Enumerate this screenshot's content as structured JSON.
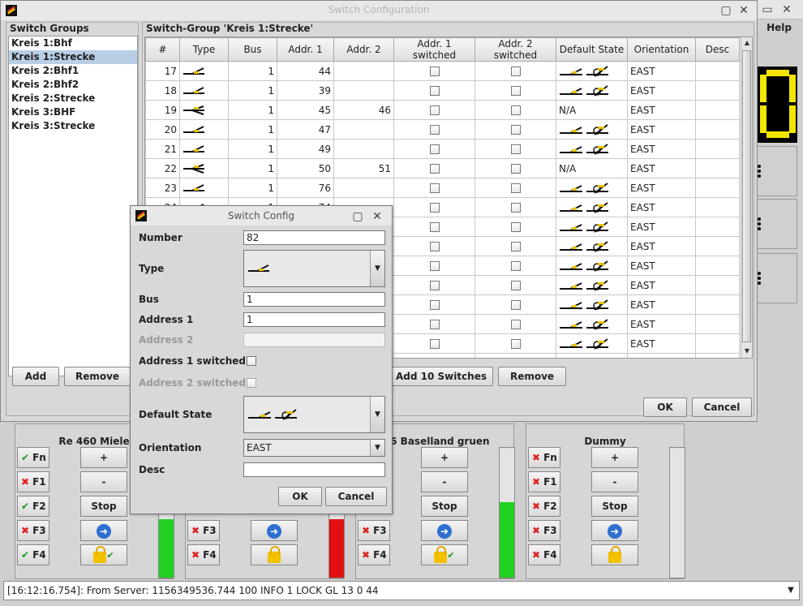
{
  "background_window": {
    "help_menu": "Help",
    "digit_value": "0"
  },
  "main_dialog": {
    "title": "Switch Configuration",
    "groups_heading": "Switch Groups",
    "groups": [
      "Kreis 1:Bhf",
      "Kreis 1:Strecke",
      "Kreis 2:Bhf1",
      "Kreis 2:Bhf2",
      "Kreis 2:Strecke",
      "Kreis 3:BHF",
      "Kreis 3:Strecke"
    ],
    "selected_group_index": 1,
    "add_label": "Add",
    "remove_label": "Remove",
    "group_heading": "Switch-Group 'Kreis 1:Strecke'",
    "columns": [
      "#",
      "Type",
      "Bus",
      "Addr. 1",
      "Addr. 2",
      "Addr. 1 switched",
      "Addr. 2 switched",
      "Default State",
      "Orientation",
      "Desc"
    ],
    "rows": [
      {
        "num": "17",
        "type": "left",
        "bus": "1",
        "addr1": "44",
        "addr2": "",
        "default": "switch",
        "orientation": "EAST",
        "desc": ""
      },
      {
        "num": "18",
        "type": "left",
        "bus": "1",
        "addr1": "39",
        "addr2": "",
        "default": "switch",
        "orientation": "EAST",
        "desc": ""
      },
      {
        "num": "19",
        "type": "three-way",
        "bus": "1",
        "addr1": "45",
        "addr2": "46",
        "default": "N/A",
        "orientation": "EAST",
        "desc": ""
      },
      {
        "num": "20",
        "type": "left",
        "bus": "1",
        "addr1": "47",
        "addr2": "",
        "default": "switch",
        "orientation": "EAST",
        "desc": ""
      },
      {
        "num": "21",
        "type": "left",
        "bus": "1",
        "addr1": "49",
        "addr2": "",
        "default": "switch",
        "orientation": "EAST",
        "desc": ""
      },
      {
        "num": "22",
        "type": "three-way",
        "bus": "1",
        "addr1": "50",
        "addr2": "51",
        "default": "N/A",
        "orientation": "EAST",
        "desc": ""
      },
      {
        "num": "23",
        "type": "left",
        "bus": "1",
        "addr1": "76",
        "addr2": "",
        "default": "switch",
        "orientation": "EAST",
        "desc": ""
      },
      {
        "num": "24",
        "type": "left",
        "bus": "1",
        "addr1": "74",
        "addr2": "",
        "default": "switch",
        "orientation": "EAST",
        "desc": ""
      },
      {
        "num": "",
        "type": "",
        "bus": "",
        "addr1": "",
        "addr2": "",
        "default": "switch",
        "orientation": "EAST",
        "desc": ""
      },
      {
        "num": "",
        "type": "",
        "bus": "",
        "addr1": "",
        "addr2": "",
        "default": "switch",
        "orientation": "EAST",
        "desc": ""
      },
      {
        "num": "",
        "type": "",
        "bus": "",
        "addr1": "",
        "addr2": "",
        "default": "switch",
        "orientation": "EAST",
        "desc": ""
      },
      {
        "num": "",
        "type": "",
        "bus": "",
        "addr1": "",
        "addr2": "",
        "default": "switch",
        "orientation": "EAST",
        "desc": ""
      },
      {
        "num": "",
        "type": "",
        "bus": "",
        "addr1": "",
        "addr2": "",
        "default": "switch",
        "orientation": "EAST",
        "desc": ""
      },
      {
        "num": "",
        "type": "",
        "bus": "",
        "addr1": "",
        "addr2": "",
        "default": "switch",
        "orientation": "EAST",
        "desc": ""
      },
      {
        "num": "",
        "type": "",
        "bus": "",
        "addr1": "",
        "addr2": "",
        "default": "switch",
        "orientation": "EAST",
        "desc": ""
      },
      {
        "num": "",
        "type": "",
        "bus": "",
        "addr1": "",
        "addr2": "",
        "default": "switch",
        "orientation": "EAST",
        "desc": ""
      }
    ],
    "add10_label": "Add 10 Switches",
    "remove2_label": "Remove",
    "ok_label": "OK",
    "cancel_label": "Cancel"
  },
  "locos": [
    {
      "name": "Re 460 Miele",
      "funcs": [
        {
          "label": "Fn",
          "on": true
        },
        {
          "label": "F1",
          "on": false
        },
        {
          "label": "F2",
          "on": true
        },
        {
          "label": "F3",
          "on": false
        },
        {
          "label": "F4",
          "on": true
        }
      ],
      "plus": "+",
      "minus": "-",
      "stop": "Stop",
      "speed_fraction": 0.45,
      "speed_color": "#22d022",
      "locked": true
    },
    {
      "name": "",
      "funcs": [
        {
          "label": "F3",
          "on": false
        },
        {
          "label": "F4",
          "on": false
        }
      ],
      "speed_fraction": 0.45,
      "speed_color": "#e01010",
      "locked": false
    },
    {
      "name": "6/6 Baselland gruen",
      "funcs": [
        {
          "label": "F3",
          "on": false
        },
        {
          "label": "F4",
          "on": false
        }
      ],
      "plus": "+",
      "minus": "-",
      "stop": "Stop",
      "speed_fraction": 0.58,
      "speed_color": "#22d022",
      "locked": true
    },
    {
      "name": "Dummy",
      "funcs": [
        {
          "label": "Fn",
          "on": false
        },
        {
          "label": "F1",
          "on": false
        },
        {
          "label": "F2",
          "on": false
        },
        {
          "label": "F3",
          "on": false
        },
        {
          "label": "F4",
          "on": false
        }
      ],
      "plus": "+",
      "minus": "-",
      "stop": "Stop",
      "speed_fraction": 0,
      "speed_color": "#22d022",
      "locked": false
    }
  ],
  "status_line": "[16:12:16.754]: From Server: 1156349536.744 100 INFO 1 LOCK GL 13 0 44",
  "switch_config": {
    "title": "Switch Config",
    "number_label": "Number",
    "number_value": "82",
    "type_label": "Type",
    "bus_label": "Bus",
    "bus_value": "1",
    "address1_label": "Address 1",
    "address1_value": "1",
    "address2_label": "Address 2",
    "address2_value": "",
    "addr1_switched_label": "Address 1 switched",
    "addr2_switched_label": "Address 2 switched",
    "default_state_label": "Default State",
    "orientation_label": "Orientation",
    "orientation_value": "EAST",
    "desc_label": "Desc",
    "desc_value": "",
    "ok_label": "OK",
    "cancel_label": "Cancel"
  }
}
